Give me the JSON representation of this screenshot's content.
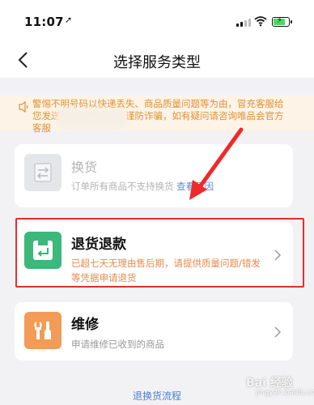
{
  "status_bar": {
    "time": "11:07",
    "location_icon": "location-arrow-icon",
    "signal_icon": "cellular-signal-icon",
    "wifi_icon": "wifi-icon",
    "battery_icon": "battery-charging-icon"
  },
  "nav": {
    "title": "选择服务类型",
    "back_icon": "chevron-left-icon"
  },
  "notice": {
    "icon": "warning-icon",
    "text": "警惕不明号码以快递丢失、商品质量问题等为由，冒充客服给您发送链接办理退款，谨防诈骗，如有疑问请咨询唯品会官方客服"
  },
  "services": [
    {
      "title": "换货",
      "desc": "订单所有商品不支持换货",
      "link": "查看原因",
      "icon": "exchange-box-icon",
      "enabled": false
    },
    {
      "title": "退货退款",
      "desc": "已超七天无理由售后期，请提供质量问题/错发等凭据申请退货",
      "icon": "return-box-icon",
      "enabled": true
    },
    {
      "title": "维修",
      "desc": "申请维修已收到的商品",
      "icon": "repair-tools-icon",
      "enabled": true
    }
  ],
  "bottom_link": "退换货流程",
  "watermark": {
    "main": "Bai 经验",
    "sub": "jingyan.baidu.com"
  },
  "colors": {
    "accent_green": "#3bb87a",
    "accent_orange": "#f29c57",
    "warning_text": "#e09035",
    "refund_desc": "#e7894c",
    "link_blue": "#4a7fd1",
    "annotation_red": "#ee2a2a"
  }
}
